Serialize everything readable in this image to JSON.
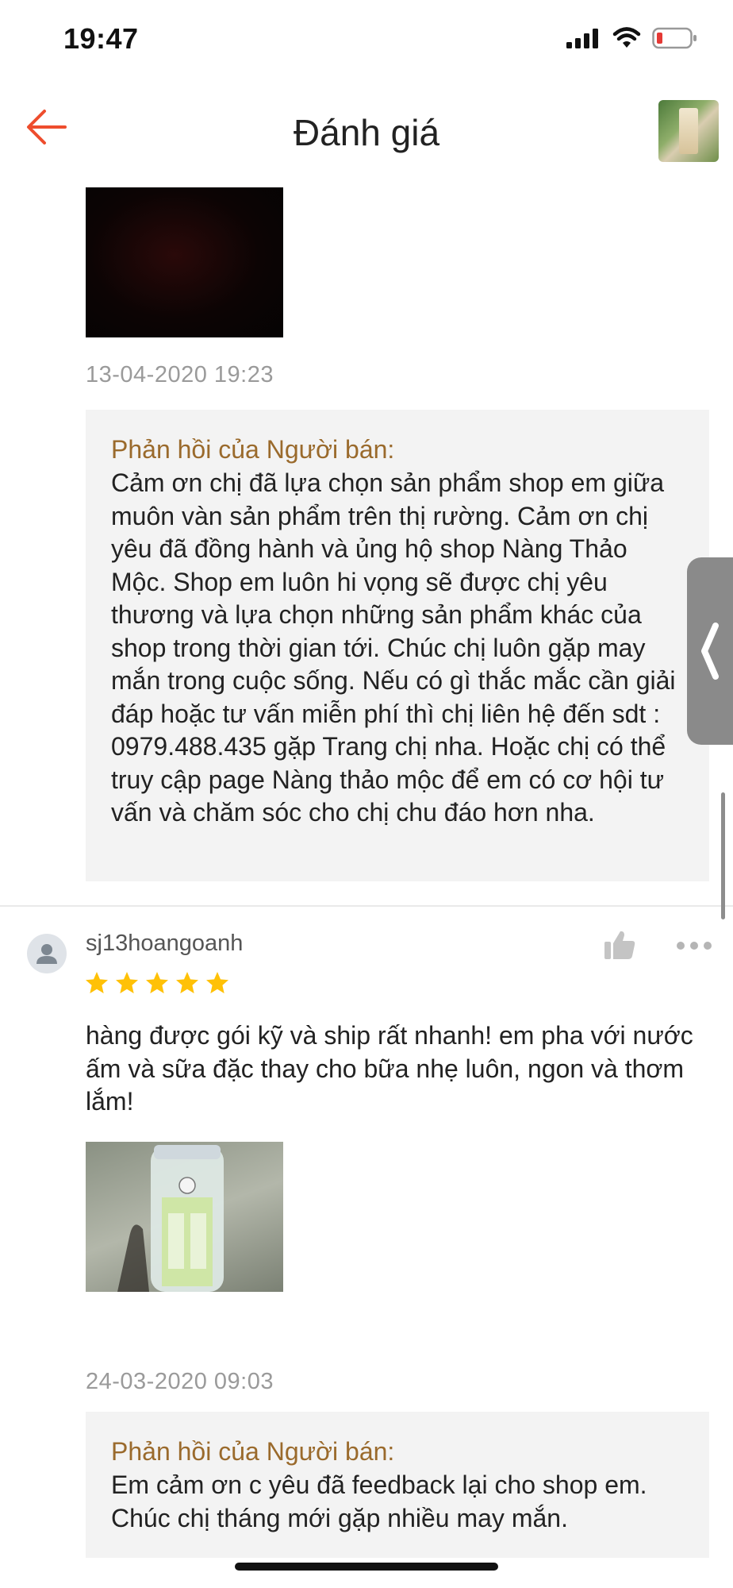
{
  "status_bar": {
    "time": "19:47"
  },
  "header": {
    "title": "Đánh giá"
  },
  "review_1": {
    "date": "13-04-2020 19:23",
    "seller_reply": {
      "label": "Phản hồi của Người bán:",
      "text": "Cảm ơn chị đã lựa chọn sản phẩm shop em giữa muôn vàn sản phẩm trên thị rường. Cảm ơn chị yêu đã đồng hành và ủng hộ shop Nàng Thảo Mộc. Shop em luôn hi vọng sẽ được chị yêu thương và lựa chọn những sản phẩm khác của shop trong thời gian tới. Chúc chị luôn gặp may mắn trong cuộc sống. Nếu có gì thắc mắc cần giải đáp hoặc tư vấn miễn phí thì chị liên hệ đến sdt : 0979.488.435 gặp Trang chị nha. Hoặc chị có thể truy cập page Nàng thảo mộc để em có cơ hội tư vấn và chăm sóc cho chị chu đáo hơn nha."
    }
  },
  "review_2": {
    "username": "sj13hoangoanh",
    "rating": 5,
    "text": "hàng được gói kỹ và ship rất nhanh! em pha với nước ấm và sữa đặc thay cho bữa nhẹ luôn, ngon và thơm lắm!",
    "date": "24-03-2020 09:03",
    "seller_reply": {
      "label": "Phản hồi của Người bán:",
      "text": "Em cảm ơn c yêu đã feedback lại cho shop em. Chúc chị tháng mới gặp nhiều may mắn."
    }
  },
  "colors": {
    "accent": "#ee4d2d",
    "star": "#ffc107",
    "reply_label": "#9a6a2c",
    "reply_bg": "#f3f3f3"
  },
  "icons": [
    "arrow-left-icon",
    "thumbs-up-icon",
    "more-horizontal-icon",
    "chevron-left-icon",
    "user-icon",
    "star-icon",
    "signal-icon",
    "wifi-icon",
    "battery-icon"
  ]
}
